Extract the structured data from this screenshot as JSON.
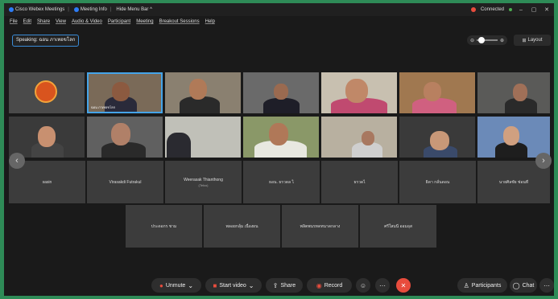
{
  "titlebar": {
    "app_name": "Cisco Webex Meetings",
    "meeting_info": "Meeting Info",
    "hide_menu": "Hide Menu Bar ^",
    "status": "Connected",
    "minimize": "–",
    "maximize": "▢",
    "close": "✕"
  },
  "menubar": {
    "items": [
      "File",
      "Edit",
      "Share",
      "View",
      "Audio & Video",
      "Participant",
      "Meeting",
      "Breakout Sessions",
      "Help"
    ]
  },
  "speaking": "Speaking: ฉอน ภาเทอขโลก",
  "zoom": {
    "minus": "⊖",
    "plus": "⊕"
  },
  "layout_label": "Layout",
  "video_tiles": [
    {
      "name": ""
    },
    {
      "name": "ฉอน ภาเทอขโลก"
    },
    {
      "name": ""
    },
    {
      "name": ""
    },
    {
      "name": ""
    },
    {
      "name": ""
    },
    {
      "name": ""
    },
    {
      "name": ""
    },
    {
      "name": ""
    },
    {
      "name": ""
    },
    {
      "name": ""
    },
    {
      "name": ""
    },
    {
      "name": ""
    },
    {
      "name": ""
    }
  ],
  "name_tiles": [
    {
      "name": "sasin",
      "sub": ""
    },
    {
      "name": "Virasakdi Futrakul",
      "sub": ""
    },
    {
      "name": "Weerasak Thianthong",
      "sub": "(Telco)"
    },
    {
      "name": "ธอน. ธรวดล ไ",
      "sub": ""
    },
    {
      "name": "ธรวดไ",
      "sub": ""
    },
    {
      "name": "ธิดา กลั่นดอน",
      "sub": ""
    },
    {
      "name": "นายศิลชัย ช่อนที",
      "sub": ""
    },
    {
      "name": "ประดอกร ชาม",
      "sub": ""
    },
    {
      "name": "พลอยกลุ้ม เนื่องผน",
      "sub": ""
    },
    {
      "name": "พลิตพนรทดทนาดกลาง",
      "sub": ""
    },
    {
      "name": "ศรีใสมนี ออมอุส",
      "sub": ""
    }
  ],
  "controls": {
    "mute": "Unmute",
    "video": "Start video",
    "share": "Share",
    "record": "Record",
    "participants": "Participants",
    "chat": "Chat"
  }
}
